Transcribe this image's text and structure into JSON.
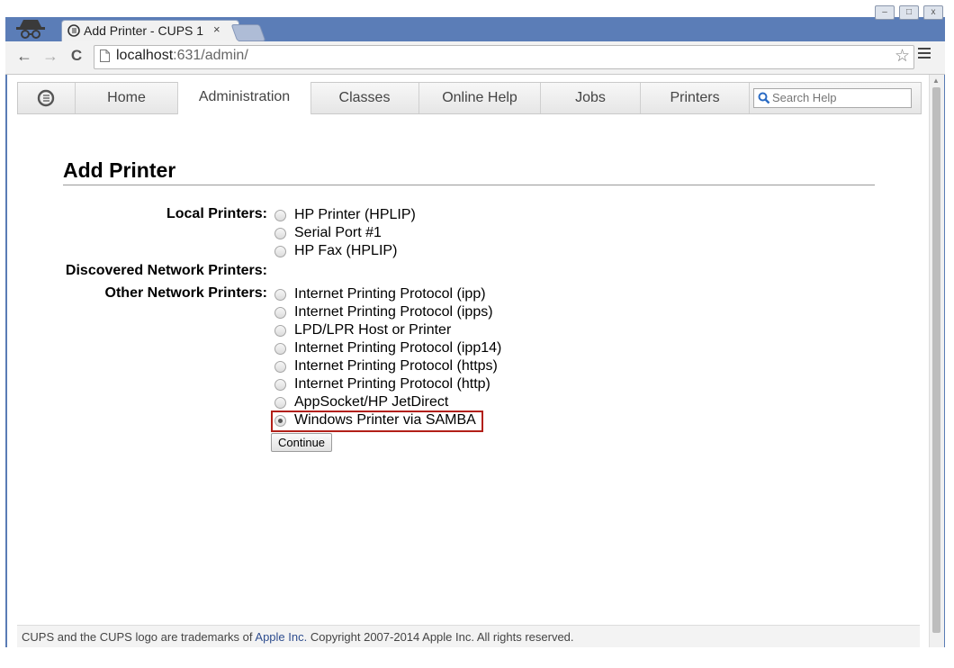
{
  "browser": {
    "tab_title": "Add Printer - CUPS 1",
    "tab_close": "×",
    "url_host": "localhost",
    "url_path": ":631/admin/",
    "back_glyph": "←",
    "forward_glyph": "→",
    "reload_glyph": "C",
    "bookmark_glyph": "☆"
  },
  "cups_nav": {
    "items": [
      {
        "label": "Home",
        "active": false
      },
      {
        "label": "Administration",
        "active": true
      },
      {
        "label": "Classes",
        "active": false
      },
      {
        "label": "Online Help",
        "active": false
      },
      {
        "label": "Jobs",
        "active": false
      },
      {
        "label": "Printers",
        "active": false
      }
    ],
    "search_placeholder": "Search Help"
  },
  "page": {
    "title": "Add Printer",
    "groups": {
      "local_label": "Local Printers:",
      "local_options": [
        "HP Printer (HPLIP)",
        "Serial Port #1",
        "HP Fax (HPLIP)"
      ],
      "discovered_label": "Discovered Network Printers:",
      "other_label": "Other Network Printers:",
      "other_options": [
        "Internet Printing Protocol (ipp)",
        "Internet Printing Protocol (ipps)",
        "LPD/LPR Host or Printer",
        "Internet Printing Protocol (ipp14)",
        "Internet Printing Protocol (https)",
        "Internet Printing Protocol (http)",
        "AppSocket/HP JetDirect",
        "Windows Printer via SAMBA"
      ],
      "selected_option": "Windows Printer via SAMBA"
    },
    "continue_label": "Continue"
  },
  "footer": {
    "text_before": "CUPS and the CUPS logo are trademarks of ",
    "link": "Apple Inc.",
    "text_after": " Copyright 2007-2014 Apple Inc. All rights reserved."
  },
  "colors": {
    "highlight_border": "#b22018",
    "frame_blue": "#5a7cb5",
    "footer_link": "#2f4e8f"
  },
  "icons": {
    "incognito": "incognito-icon",
    "favicon": "cups-favicon-icon",
    "page": "page-icon",
    "bookmark": "bookmark-star-icon",
    "menu": "hamburger-menu-icon",
    "cups_logo": "cups-logo-icon",
    "search": "search-icon"
  }
}
